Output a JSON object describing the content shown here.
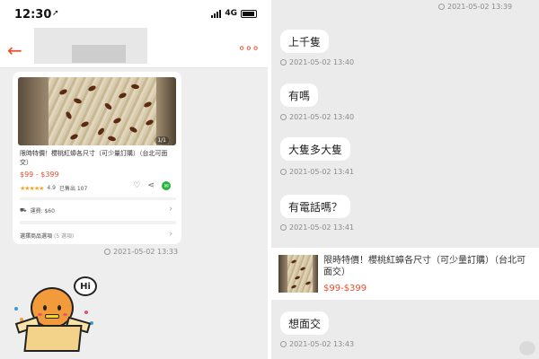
{
  "left": {
    "status": {
      "time": "12:30",
      "network": "4G"
    },
    "header": {
      "back": "←",
      "more": "∘∘∘"
    },
    "product_card": {
      "page_badge": "1/1",
      "title": "限時特價！櫻桃紅蟑各尺寸（可少量訂購）（台北可面交）",
      "price": "$99 - $399",
      "rating": "4.9",
      "sold": "已售出 107",
      "shipping": "運費: $60",
      "more_label": "選擇商品選項",
      "more_count": "(5 選項)",
      "rating_stars": 5
    },
    "timestamp": "2021-05-02 13:33",
    "sticker_text": "Hi"
  },
  "right": {
    "top_timestamp": "2021-05-02 13:39",
    "messages": [
      {
        "text": "上千隻",
        "time": "2021-05-02 13:40"
      },
      {
        "text": "有嗎",
        "time": "2021-05-02 13:40"
      },
      {
        "text": "大隻多大隻",
        "time": "2021-05-02 13:41"
      },
      {
        "text": "有電話嗎？",
        "time": "2021-05-02 13:41"
      }
    ],
    "product_message": {
      "title": "限時特價！櫻桃紅蟑各尺寸（可少量訂購）（台北可面交）",
      "price": "$99-$399"
    },
    "last_message": {
      "text": "想面交",
      "time": "2021-05-02 13:43"
    }
  },
  "colors": {
    "accent": "#ee4d2d",
    "chat_bg": "#ebebeb",
    "bubble": "#ffffff",
    "star": "#f5a623"
  }
}
